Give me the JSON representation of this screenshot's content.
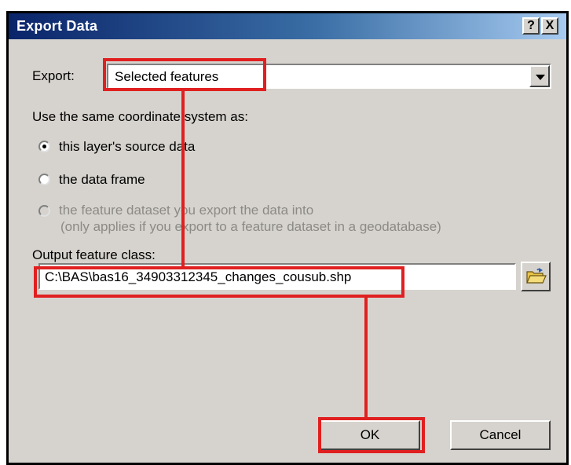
{
  "dialog": {
    "title": "Export Data",
    "help_button": "?",
    "close_button": "X"
  },
  "export": {
    "label": "Export:",
    "selected": "Selected features"
  },
  "coordinate": {
    "heading": "Use the same coordinate system as:",
    "options": [
      {
        "label": "this layer's source data",
        "checked": true,
        "enabled": true
      },
      {
        "label": "the data frame",
        "checked": false,
        "enabled": true
      },
      {
        "label": "the feature dataset you export the data into",
        "sublabel": "(only applies if you export to a feature dataset in a geodatabase)",
        "checked": false,
        "enabled": false
      }
    ]
  },
  "output": {
    "label": "Output feature class:",
    "value": "C:\\BAS\\bas16_34903312345_changes_cousub.shp"
  },
  "buttons": {
    "ok": "OK",
    "cancel": "Cancel"
  },
  "annotation_color": "#e02020"
}
